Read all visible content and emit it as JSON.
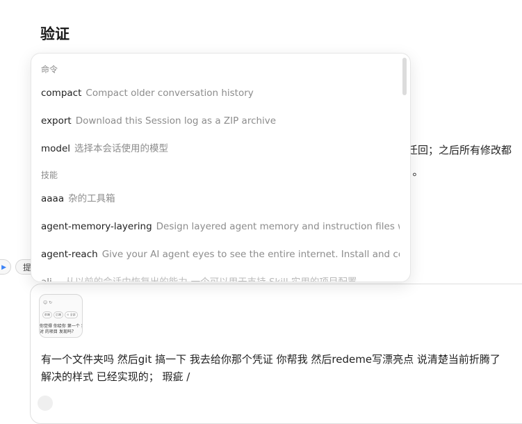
{
  "page": {
    "title": "验证"
  },
  "background": {
    "line1": "迁回；之后所有修改都",
    "line2": "）。",
    "chip_a": "▶",
    "chip_b": "提"
  },
  "composer": {
    "message_line1": "有一个文件夹吗 然后git 搞一下 我去给你那个凭证 你帮我 然后redeme写漂亮点 说清楚当前折腾了",
    "message_line2": "解决的样式 已经实现的； 瑕疵 /",
    "thumbnail": {
      "icons": "☺  ↻",
      "buttons": [
        "前端",
        "后端",
        "⊙ 全部"
      ],
      "text_line1": "你觉得 你给你 第一个 我",
      "text_line2": "对 的项目 发现吗？"
    }
  },
  "command_popup": {
    "sections": [
      {
        "header": "命令",
        "items": [
          {
            "name": "compact",
            "description": "Compact older conversation history"
          },
          {
            "name": "export",
            "description": "Download this Session log as a ZIP archive"
          },
          {
            "name": "model",
            "description": "选择本会话使用的模型"
          }
        ]
      },
      {
        "header": "技能",
        "items": [
          {
            "name": "aaaa",
            "description": "杂的工具箱"
          },
          {
            "name": "agent-memory-layering",
            "description": "Design layered agent memory and instruction files with..."
          },
          {
            "name": "agent-reach",
            "description": "Give your AI agent eyes to see the entire internet. Install and config..."
          },
          {
            "name": "ali…",
            "description": "从以前的会话中恢复出的能力-一个可以用于支持 Skill 实用的项目配置 …"
          }
        ]
      }
    ]
  }
}
